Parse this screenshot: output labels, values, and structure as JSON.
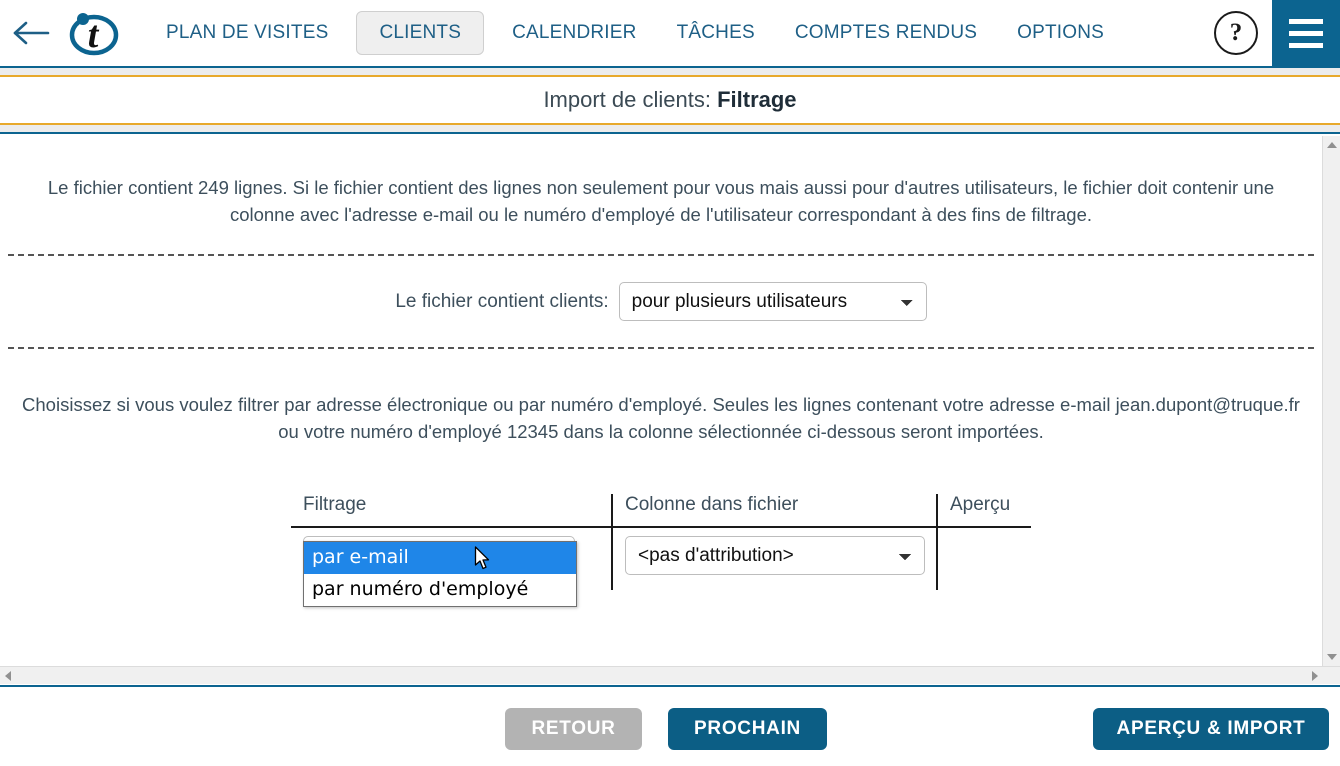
{
  "nav": {
    "back_icon": "back-arrow-icon",
    "logo_letter": "t",
    "links": [
      {
        "label": "PLAN DE VISITES",
        "active": false
      },
      {
        "label": "CLIENTS",
        "active": true
      },
      {
        "label": "CALENDRIER",
        "active": false
      },
      {
        "label": "TÂCHES",
        "active": false
      },
      {
        "label": "COMPTES RENDUS",
        "active": false
      },
      {
        "label": "OPTIONS",
        "active": false
      }
    ],
    "help_label": "?",
    "menu_icon": "hamburger-menu-icon"
  },
  "page": {
    "title_prefix": "Import de clients: ",
    "title_emphasis": "Filtrage"
  },
  "main": {
    "intro_paragraph": "Le fichier contient 249 lignes. Si le fichier contient des lignes non seulement pour vous mais aussi pour d'autres utilisateurs, le fichier doit contenir une colonne avec l'adresse e-mail ou le numéro d'employé de l'utilisateur correspondant à des fins de filtrage.",
    "line_count": "249",
    "file_contains": {
      "label": "Le fichier contient clients:",
      "value": "pour plusieurs utilisateurs",
      "options": [
        "pour plusieurs utilisateurs"
      ]
    },
    "filter_paragraph": "Choisissez si vous voulez filtrer par adresse électronique ou par numéro d'employé. Seules les lignes contenant votre adresse e-mail jean.dupont@truque.fr ou votre numéro d'employé 12345 dans la colonne sélectionnée ci-dessous seront importées.",
    "user_email": "jean.dupont@truque.fr",
    "employee_number": "12345",
    "table": {
      "headers": [
        "Filtrage",
        "Colonne dans fichier",
        "Aperçu"
      ],
      "filter_select": {
        "value": "par e-mail",
        "options": [
          "par e-mail",
          "par numéro d'employé"
        ]
      },
      "column_select": {
        "value": "<pas d'attribution>",
        "options": [
          "<pas d'attribution>"
        ]
      },
      "preview_value": ""
    },
    "dropdown_open": {
      "items": [
        {
          "label": "par e-mail",
          "selected": true
        },
        {
          "label": "par numéro d'employé",
          "selected": false
        }
      ]
    }
  },
  "footer": {
    "back_label": "RETOUR",
    "next_label": "PROCHAIN",
    "preview_import_label": "APERÇU & IMPORT"
  },
  "colors": {
    "brand_blue": "#0c6490",
    "button_blue": "#0c5e85",
    "button_gray": "#b3b3b3",
    "accent_orange": "#e8a92b",
    "link_blue": "#1e5f86",
    "highlight_blue": "#1f86e8",
    "text": "#3d4f5c"
  }
}
